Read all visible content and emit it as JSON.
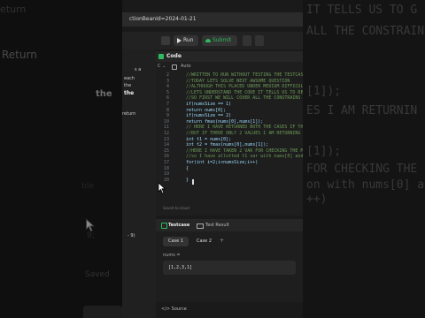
{
  "background": {
    "left_words": [
      "Return",
      "the",
      "eturn"
    ],
    "right_lines": [
      "IT TELLS US TO G",
      "ALL THE CONSTRAIN",
      "[1]);",
      "ES I AM RETURNIN",
      "[1]);",
      "FOR CHECKING THE",
      "on with nums[0] and",
      "++)"
    ],
    "left_code": [
      "ble",
      "9;",
      "Saved"
    ]
  },
  "browser": {
    "url_text": "ctionBeanId=2024-01-21"
  },
  "toolbar": {
    "run_label": "Run",
    "submit_label": "Submit"
  },
  "sidebar": {
    "texts": [
      "s a",
      "each",
      "the",
      "the",
      "return",
      "- 9)"
    ]
  },
  "editor": {
    "panel_title": "Code",
    "lang_label": "Auto",
    "lines": [
      {
        "n": "2",
        "t": "//WRITTEN TO RUN WITHOUT TESTING THE TESTCASE",
        "k": "comment"
      },
      {
        "n": "3",
        "t": "//TODAY LETS SOLVE NEXT AWSOME QUESTION",
        "k": "comment"
      },
      {
        "n": "4",
        "t": "//ALTHOUGH THIS PLACED UNDER MEDIUM DIFFICULTY",
        "k": "comment"
      },
      {
        "n": "5",
        "t": "//LETS UNDERSTAND THE CODE IT TELLS US TO RETURN",
        "k": "comment"
      },
      {
        "n": "6",
        "t": "//SO FIRST WE WILL COVER ALL THE CONSTRAINS",
        "k": "comment"
      },
      {
        "n": "7",
        "t": "if(numsSize == 1)",
        "k": "code"
      },
      {
        "n": "8",
        "t": "return nums[0];",
        "k": "code"
      },
      {
        "n": "9",
        "t": "if(numsSize == 2)",
        "k": "code"
      },
      {
        "n": "10",
        "t": "return fmax(nums[0],nums[1]);",
        "k": "code"
      },
      {
        "n": "11",
        "t": "// HERE I HAVE RETURNED BOTH THE CASES IF THE",
        "k": "comment"
      },
      {
        "n": "12",
        "t": "//BUT IF THERE ONLY 2 VALUES I AM RETURNING THE",
        "k": "comment"
      },
      {
        "n": "13",
        "t": "int t1 = nums[0];",
        "k": "code"
      },
      {
        "n": "14",
        "t": "int t2 = fmax(nums[0],nums[1]);",
        "k": "code"
      },
      {
        "n": "15",
        "t": "//HERE I HAVE TAKEN 2 VAR FOR CHECKING THE MAX",
        "k": "comment"
      },
      {
        "n": "16",
        "t": "//so I have allotted t1 var with nums[0] and",
        "k": "comment"
      },
      {
        "n": "17",
        "t": "for(int i=2;i<numsSize;i++)",
        "k": "code"
      },
      {
        "n": "18",
        "t": "{",
        "k": "code"
      },
      {
        "n": "19",
        "t": "",
        "k": "code"
      },
      {
        "n": "20",
        "t": "}",
        "k": "code"
      }
    ],
    "saved_text": "Saved to cloud"
  },
  "testcase": {
    "tab_testcase": "Testcase",
    "tab_result": "Test Result",
    "case1": "Case 1",
    "case2": "Case 2",
    "add": "+",
    "input_label": "nums =",
    "input_value": "[1,2,3,1]"
  },
  "footer": {
    "source_label": "Source"
  },
  "colors": {
    "submit_green": "#2cbb5d",
    "tab_green": "#2cbb5d",
    "comment": "#6a9955",
    "code": "#9cdcfe"
  }
}
